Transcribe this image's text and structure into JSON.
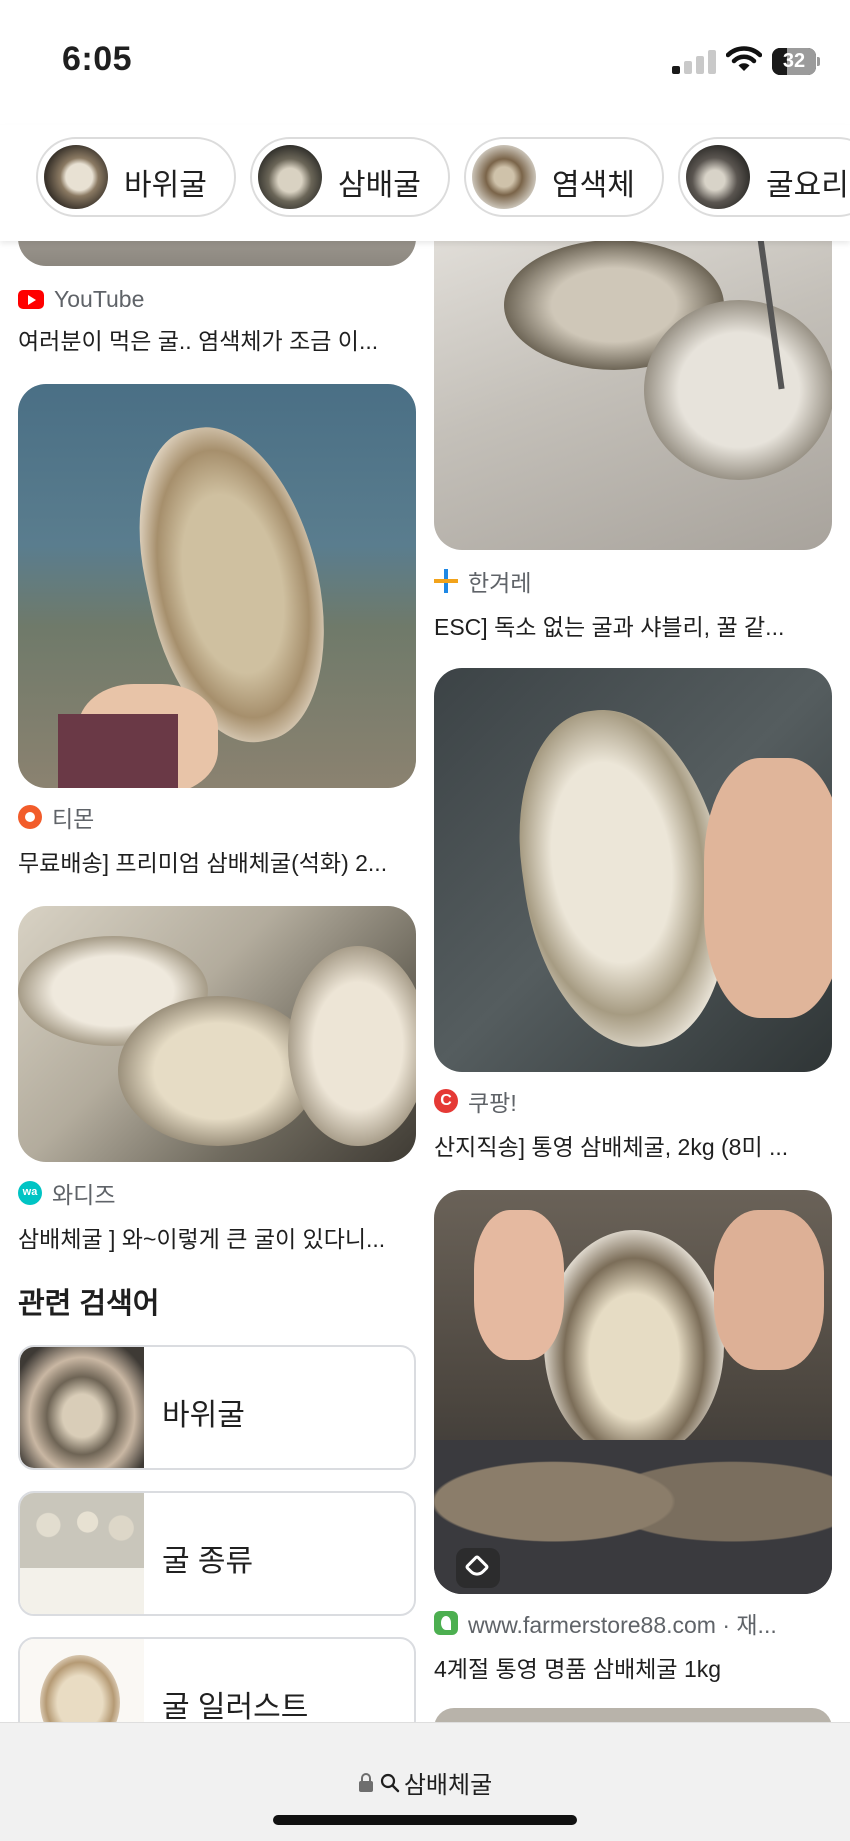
{
  "status_bar": {
    "time": "6:05",
    "battery": "32",
    "icons": [
      "signal-icon",
      "wifi-icon",
      "battery-icon"
    ]
  },
  "chips": [
    {
      "label": "바위굴"
    },
    {
      "label": "삼배굴"
    },
    {
      "label": "염색체"
    },
    {
      "label": "굴요리"
    }
  ],
  "results_left": [
    {
      "source": "YouTube",
      "title": "여러분이 먹은 굴.. 염색체가 조금 이...",
      "source_color": "#ff0000"
    },
    {
      "source": "티몬",
      "title": "무료배송] 프리미엄 삼배체굴(석화) 2...",
      "source_color": "#f25c2a"
    },
    {
      "source": "와디즈",
      "title": "삼배체굴 ] 와~이렇게 큰 굴이 있다니...",
      "source_color": "#00c4c4",
      "icon_text": "wa"
    }
  ],
  "results_right": [
    {
      "source": "한겨레",
      "title": "ESC] 독소 없는 굴과 샤블리, 꿀 같...",
      "source_color": "#1e88e5"
    },
    {
      "source": "쿠팡!",
      "title": "산지직송] 통영 삼배체굴, 2kg (8미 ...",
      "source_color": "#e53935",
      "icon_text": "C"
    },
    {
      "source": "www.farmerstore88.com · 재...",
      "title": "4계절 통영 명품 삼배체굴 1kg",
      "source_color": "#4caf50"
    }
  ],
  "related": {
    "heading": "관련 검색어",
    "items": [
      {
        "label": "바위굴"
      },
      {
        "label": "굴 종류"
      },
      {
        "label": "굴 일러스트"
      }
    ]
  },
  "bottom_bar": {
    "query": "삼배체굴"
  }
}
